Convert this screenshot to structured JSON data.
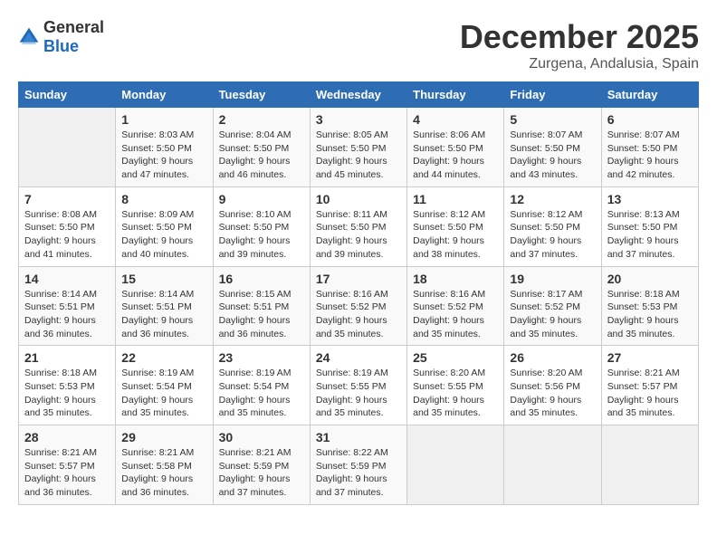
{
  "logo": {
    "text_general": "General",
    "text_blue": "Blue"
  },
  "title": {
    "month_year": "December 2025",
    "location": "Zurgena, Andalusia, Spain"
  },
  "headers": [
    "Sunday",
    "Monday",
    "Tuesday",
    "Wednesday",
    "Thursday",
    "Friday",
    "Saturday"
  ],
  "weeks": [
    [
      {
        "day": "",
        "info": ""
      },
      {
        "day": "1",
        "info": "Sunrise: 8:03 AM\nSunset: 5:50 PM\nDaylight: 9 hours\nand 47 minutes."
      },
      {
        "day": "2",
        "info": "Sunrise: 8:04 AM\nSunset: 5:50 PM\nDaylight: 9 hours\nand 46 minutes."
      },
      {
        "day": "3",
        "info": "Sunrise: 8:05 AM\nSunset: 5:50 PM\nDaylight: 9 hours\nand 45 minutes."
      },
      {
        "day": "4",
        "info": "Sunrise: 8:06 AM\nSunset: 5:50 PM\nDaylight: 9 hours\nand 44 minutes."
      },
      {
        "day": "5",
        "info": "Sunrise: 8:07 AM\nSunset: 5:50 PM\nDaylight: 9 hours\nand 43 minutes."
      },
      {
        "day": "6",
        "info": "Sunrise: 8:07 AM\nSunset: 5:50 PM\nDaylight: 9 hours\nand 42 minutes."
      }
    ],
    [
      {
        "day": "7",
        "info": "Sunrise: 8:08 AM\nSunset: 5:50 PM\nDaylight: 9 hours\nand 41 minutes."
      },
      {
        "day": "8",
        "info": "Sunrise: 8:09 AM\nSunset: 5:50 PM\nDaylight: 9 hours\nand 40 minutes."
      },
      {
        "day": "9",
        "info": "Sunrise: 8:10 AM\nSunset: 5:50 PM\nDaylight: 9 hours\nand 39 minutes."
      },
      {
        "day": "10",
        "info": "Sunrise: 8:11 AM\nSunset: 5:50 PM\nDaylight: 9 hours\nand 39 minutes."
      },
      {
        "day": "11",
        "info": "Sunrise: 8:12 AM\nSunset: 5:50 PM\nDaylight: 9 hours\nand 38 minutes."
      },
      {
        "day": "12",
        "info": "Sunrise: 8:12 AM\nSunset: 5:50 PM\nDaylight: 9 hours\nand 37 minutes."
      },
      {
        "day": "13",
        "info": "Sunrise: 8:13 AM\nSunset: 5:50 PM\nDaylight: 9 hours\nand 37 minutes."
      }
    ],
    [
      {
        "day": "14",
        "info": "Sunrise: 8:14 AM\nSunset: 5:51 PM\nDaylight: 9 hours\nand 36 minutes."
      },
      {
        "day": "15",
        "info": "Sunrise: 8:14 AM\nSunset: 5:51 PM\nDaylight: 9 hours\nand 36 minutes."
      },
      {
        "day": "16",
        "info": "Sunrise: 8:15 AM\nSunset: 5:51 PM\nDaylight: 9 hours\nand 36 minutes."
      },
      {
        "day": "17",
        "info": "Sunrise: 8:16 AM\nSunset: 5:52 PM\nDaylight: 9 hours\nand 35 minutes."
      },
      {
        "day": "18",
        "info": "Sunrise: 8:16 AM\nSunset: 5:52 PM\nDaylight: 9 hours\nand 35 minutes."
      },
      {
        "day": "19",
        "info": "Sunrise: 8:17 AM\nSunset: 5:52 PM\nDaylight: 9 hours\nand 35 minutes."
      },
      {
        "day": "20",
        "info": "Sunrise: 8:18 AM\nSunset: 5:53 PM\nDaylight: 9 hours\nand 35 minutes."
      }
    ],
    [
      {
        "day": "21",
        "info": "Sunrise: 8:18 AM\nSunset: 5:53 PM\nDaylight: 9 hours\nand 35 minutes."
      },
      {
        "day": "22",
        "info": "Sunrise: 8:19 AM\nSunset: 5:54 PM\nDaylight: 9 hours\nand 35 minutes."
      },
      {
        "day": "23",
        "info": "Sunrise: 8:19 AM\nSunset: 5:54 PM\nDaylight: 9 hours\nand 35 minutes."
      },
      {
        "day": "24",
        "info": "Sunrise: 8:19 AM\nSunset: 5:55 PM\nDaylight: 9 hours\nand 35 minutes."
      },
      {
        "day": "25",
        "info": "Sunrise: 8:20 AM\nSunset: 5:55 PM\nDaylight: 9 hours\nand 35 minutes."
      },
      {
        "day": "26",
        "info": "Sunrise: 8:20 AM\nSunset: 5:56 PM\nDaylight: 9 hours\nand 35 minutes."
      },
      {
        "day": "27",
        "info": "Sunrise: 8:21 AM\nSunset: 5:57 PM\nDaylight: 9 hours\nand 35 minutes."
      }
    ],
    [
      {
        "day": "28",
        "info": "Sunrise: 8:21 AM\nSunset: 5:57 PM\nDaylight: 9 hours\nand 36 minutes."
      },
      {
        "day": "29",
        "info": "Sunrise: 8:21 AM\nSunset: 5:58 PM\nDaylight: 9 hours\nand 36 minutes."
      },
      {
        "day": "30",
        "info": "Sunrise: 8:21 AM\nSunset: 5:59 PM\nDaylight: 9 hours\nand 37 minutes."
      },
      {
        "day": "31",
        "info": "Sunrise: 8:22 AM\nSunset: 5:59 PM\nDaylight: 9 hours\nand 37 minutes."
      },
      {
        "day": "",
        "info": ""
      },
      {
        "day": "",
        "info": ""
      },
      {
        "day": "",
        "info": ""
      }
    ]
  ]
}
